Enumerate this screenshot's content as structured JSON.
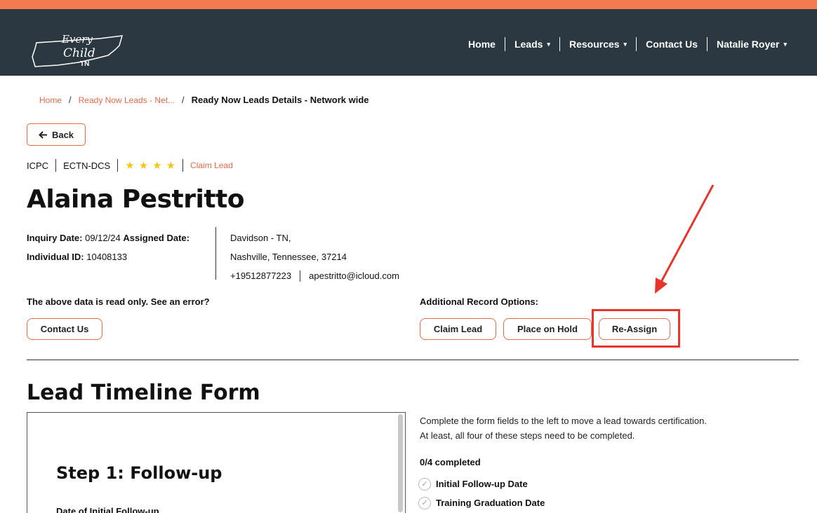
{
  "header": {
    "logo_text": [
      "Every",
      "Child",
      "TN"
    ],
    "nav": [
      {
        "label": "Home",
        "dropdown": false
      },
      {
        "label": "Leads",
        "dropdown": true
      },
      {
        "label": "Resources",
        "dropdown": true
      },
      {
        "label": "Contact Us",
        "dropdown": false
      },
      {
        "label": "Natalie Royer",
        "dropdown": true
      }
    ],
    "caret": "▾"
  },
  "breadcrumb": {
    "home": "Home",
    "leads": "Ready Now Leads - Net...",
    "current": "Ready Now Leads Details - Network wide",
    "separator": "/"
  },
  "back_button": {
    "label": "Back",
    "icon": "arrow-left-icon",
    "glyph": "🡐"
  },
  "meta": {
    "type": "ICPC",
    "agency": "ECTN-DCS",
    "rating": 4,
    "star_glyph": "★",
    "claim_link": "Claim Lead"
  },
  "lead": {
    "name": "Alaina Pestritto",
    "inquiry_date_label": "Inquiry Date:",
    "inquiry_date": "09/12/24",
    "assigned_date_label": "Assigned Date:",
    "assigned_date": "",
    "individual_id_label": "Individual ID:",
    "individual_id": "10408133",
    "county": "Davidson - TN,",
    "city_state_zip": "Nashville, Tennessee, 37214",
    "phone": "+19512877223",
    "email": "apestritto@icloud.com"
  },
  "readonly": {
    "notice": "The above data is read only. See an error?",
    "contact_button": "Contact Us"
  },
  "record_options": {
    "label": "Additional Record Options:",
    "claim_button": "Claim Lead",
    "hold_button": "Place on Hold",
    "reassign_button": "Re-Assign"
  },
  "annotation": {
    "color": "#e8352b"
  },
  "timeline": {
    "title": "Lead Timeline Form",
    "step_title": "Step 1: Follow-up",
    "step_field_label": "Date of Initial Follow-up",
    "description_1": "Complete the form fields to the left to move a lead towards certification.",
    "description_2": "At least, all four of these steps need to be completed.",
    "progress": "0/4 completed",
    "checklist": [
      {
        "label": "Initial Follow-up Date",
        "done": false
      },
      {
        "label": "Training Graduation Date",
        "done": false
      }
    ],
    "check_glyph": "✓"
  },
  "colors": {
    "accent": "#e96a45",
    "top_strip": "#f47a50",
    "navbar": "#2b3841",
    "star": "#f5c518"
  }
}
